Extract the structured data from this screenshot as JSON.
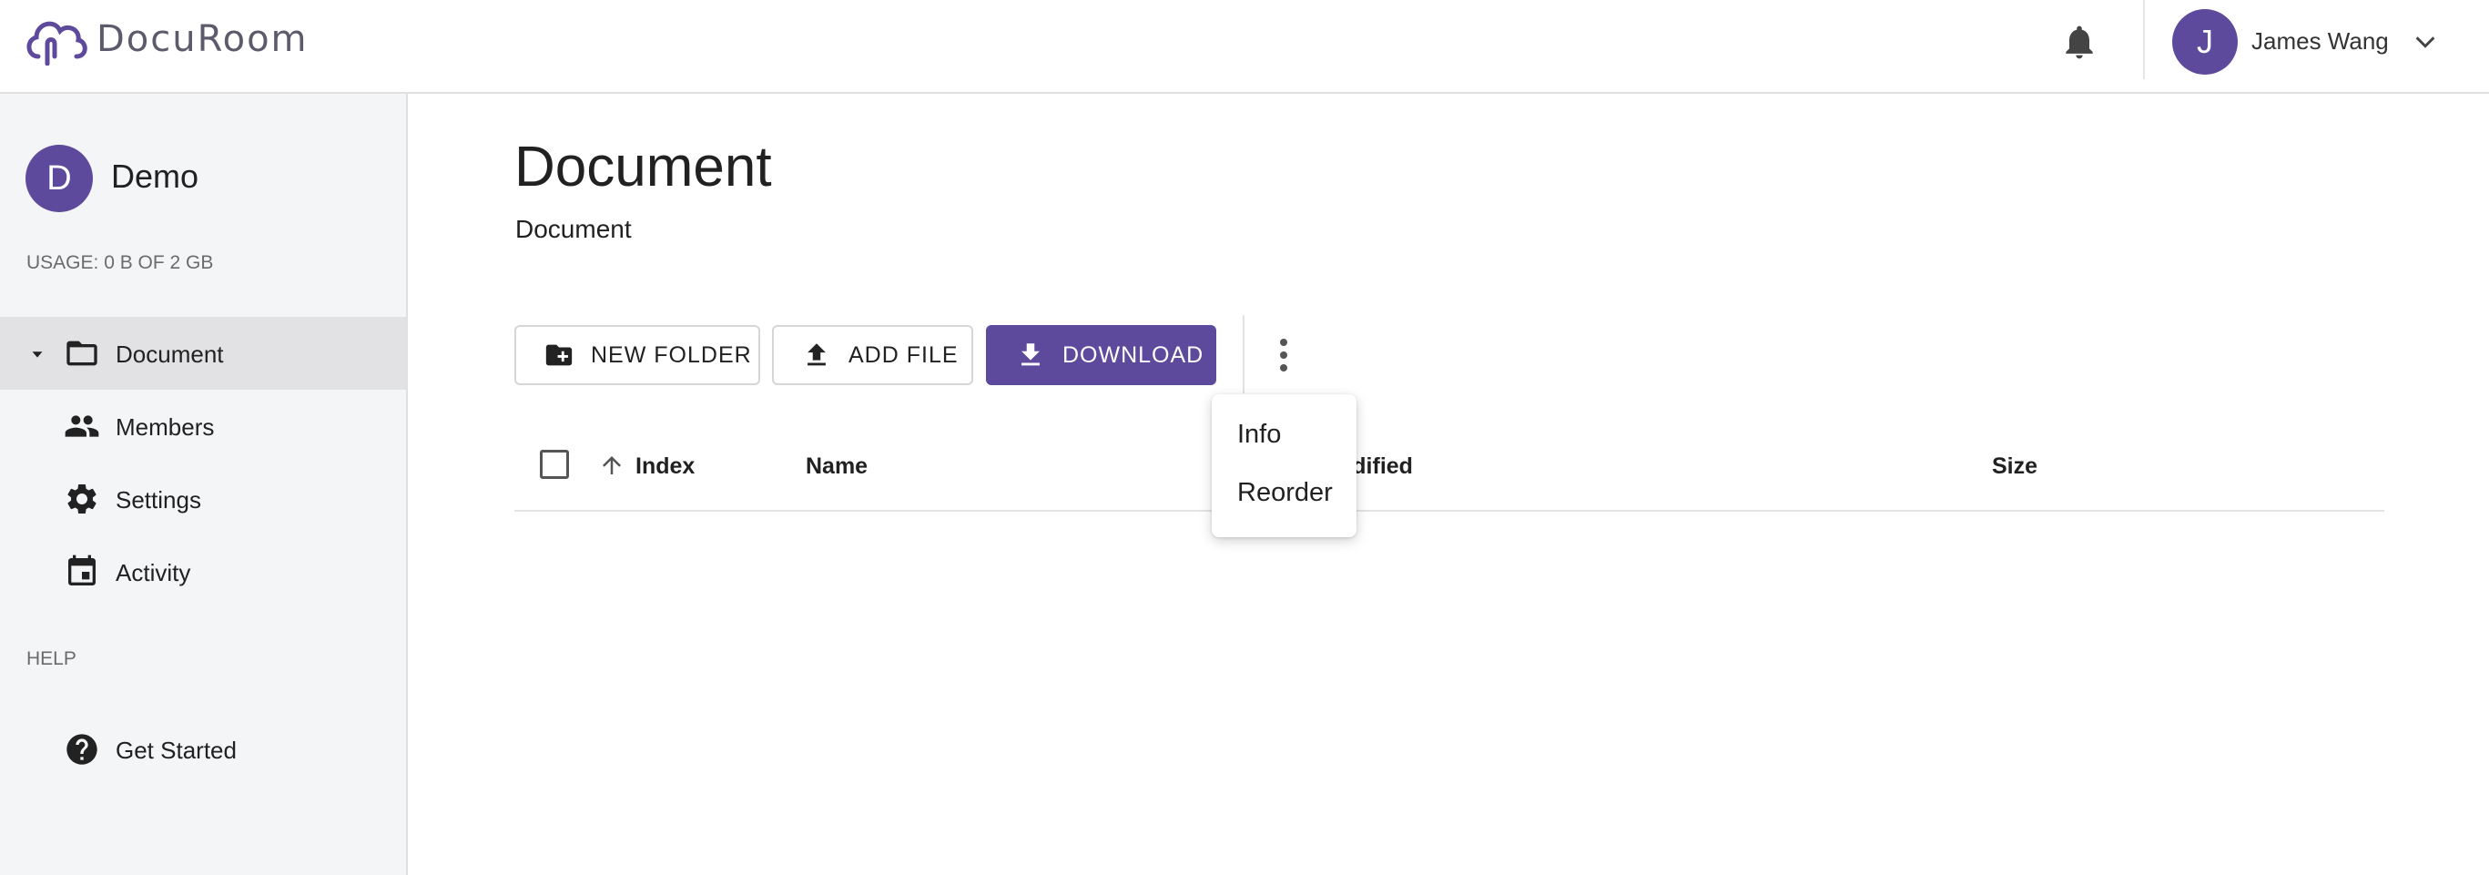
{
  "header": {
    "app_name": "DocuRoom",
    "user": {
      "initial": "J",
      "name": "James Wang"
    }
  },
  "sidebar": {
    "org": {
      "initial": "D",
      "name": "Demo"
    },
    "usage": "USAGE: 0 B OF 2 GB",
    "items": [
      {
        "label": "Document",
        "icon": "folder-open-icon",
        "active": true
      },
      {
        "label": "Members",
        "icon": "people-icon"
      },
      {
        "label": "Settings",
        "icon": "gear-icon"
      },
      {
        "label": "Activity",
        "icon": "calendar-icon"
      }
    ],
    "help_heading": "HELP",
    "help_items": [
      {
        "label": "Get Started",
        "icon": "help-circle-icon"
      }
    ]
  },
  "main": {
    "title": "Document",
    "breadcrumb": "Document",
    "toolbar": {
      "new_folder": "NEW FOLDER",
      "add_file": "ADD FILE",
      "download": "DOWNLOAD"
    },
    "table": {
      "columns": [
        "Index",
        "Name",
        "odified",
        "Size"
      ]
    },
    "menu": {
      "items": [
        "Info",
        "Reorder"
      ]
    }
  },
  "colors": {
    "accent": "#5e4a9c",
    "sidebar_bg": "#f4f5f7",
    "active_item_bg": "#e2e2e4"
  }
}
